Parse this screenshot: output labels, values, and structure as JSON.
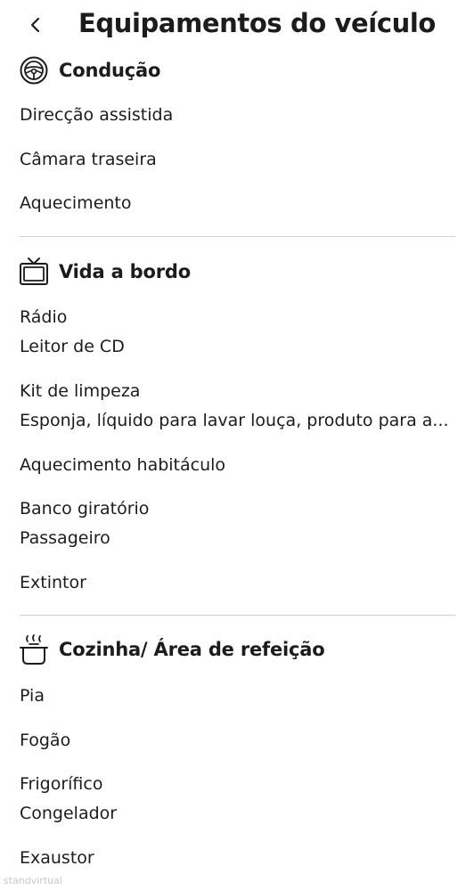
{
  "header": {
    "title": "Equipamentos do veículo"
  },
  "sections": [
    {
      "title": "Condução",
      "icon": "steering-wheel-icon",
      "items": [
        "Direcção assistida",
        "Câmara traseira",
        "Aquecimento"
      ]
    },
    {
      "title": "Vida a bordo",
      "icon": "tv-icon",
      "items": [
        "Rádio",
        "Leitor de CD",
        "Kit de limpeza",
        "Esponja, líquido para lavar louça, produto para a...",
        "Aquecimento habitáculo",
        "Banco giratório",
        "Passageiro",
        "Extintor"
      ]
    },
    {
      "title": "Cozinha/ Área de refeição",
      "icon": "cooking-pot-icon",
      "items": [
        "Pia",
        "Fogão",
        "Frigorífico",
        "Congelador",
        "Exaustor"
      ]
    }
  ],
  "watermark": "standvirtual"
}
